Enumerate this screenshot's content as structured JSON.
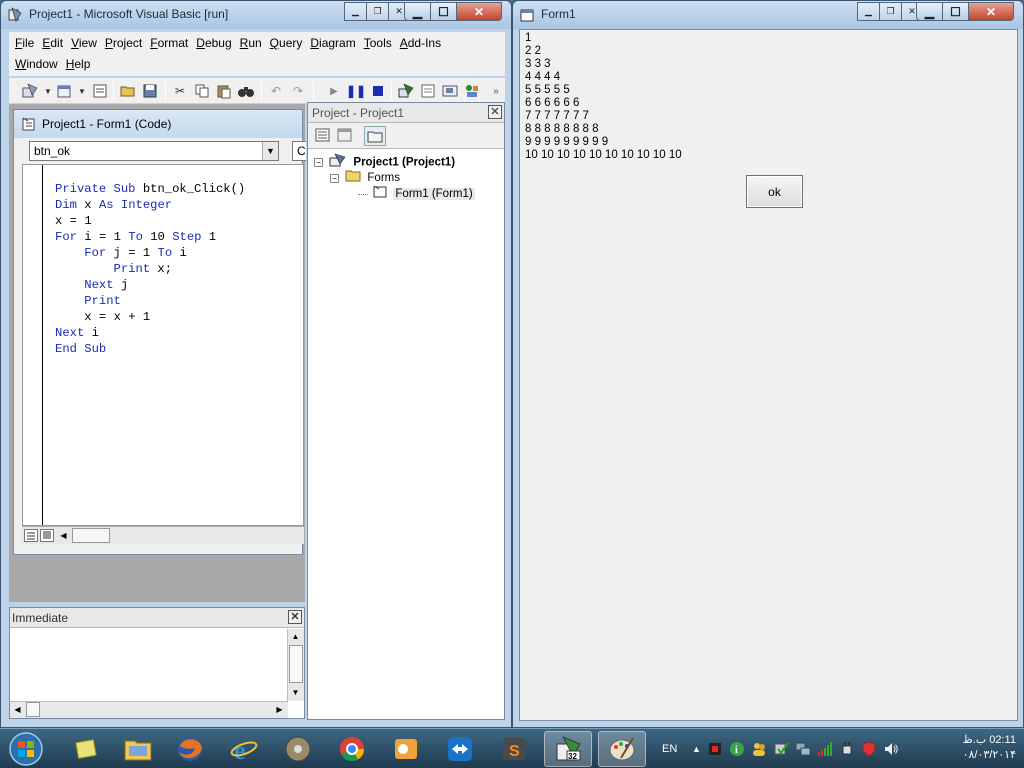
{
  "vb_window": {
    "title": "Project1 - Microsoft Visual Basic [run]",
    "menu_row1": [
      "File",
      "Edit",
      "View",
      "Project",
      "Format",
      "Debug",
      "Run",
      "Query",
      "Diagram",
      "Tools",
      "Add-Ins"
    ],
    "menu_row2": [
      "Window",
      "Help"
    ]
  },
  "code_window": {
    "title": "Project1 - Form1 (Code)",
    "object_combo": "btn_ok",
    "proc_combo": "C",
    "lines": [
      "Private Sub btn_ok_Click()",
      "Dim x As Integer",
      "x = 1",
      "For i = 1 To 10 Step 1",
      "    For j = 1 To i",
      "        Print x;",
      "    Next j",
      "    Print",
      "    x = x + 1",
      "Next i",
      "End Sub"
    ]
  },
  "immediate": {
    "title": "Immediate"
  },
  "project_explorer": {
    "title": "Project - Project1",
    "tree": {
      "project": "Project1 (Project1)",
      "folder": "Forms",
      "form": "Form1 (Form1)"
    }
  },
  "form1_window": {
    "title": "Form1",
    "output_lines": [
      "1",
      "2 2",
      "3 3 3",
      "4 4 4 4",
      "5 5 5 5 5",
      "6 6 6 6 6 6",
      "7 7 7 7 7 7 7",
      "8 8 8 8 8 8 8 8",
      "9 9 9 9 9 9 9 9 9",
      "10 10 10 10 10 10 10 10 10 10"
    ],
    "button_label": "ok"
  },
  "taskbar": {
    "language": "EN",
    "time": "02:11 ب.ظ",
    "date": "۰۸/۰۳/۲۰۱۴"
  },
  "colors": {
    "code_keyword": "#1a2bb5",
    "close_button": "#c4452d",
    "titlebar": "#bcd3ea"
  }
}
